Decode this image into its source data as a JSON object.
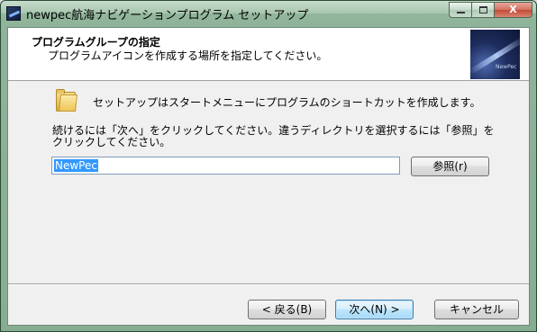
{
  "window": {
    "title": "newpec航海ナビゲーションプログラム セットアップ",
    "minimize_label": "",
    "maximize_label": "",
    "close_label": "X"
  },
  "header": {
    "title": "プログラムグループの指定",
    "subtitle": "プログラムアイコンを作成する場所を指定してください。",
    "image_caption": "NewPec"
  },
  "body": {
    "intro": "セットアップはスタートメニューにプログラムのショートカットを作成します。",
    "instruction": "続けるには「次へ」をクリックしてください。違うディレクトリを選択するには「参照」をクリックしてください。",
    "folder_value": "NewPec",
    "browse_label": "参照(r)"
  },
  "footer": {
    "back_label": "< 戻る(B)",
    "next_label": "次へ(N) >",
    "cancel_label": "キャンセル"
  },
  "colors": {
    "title_bar": "#9fc0a7",
    "selection": "#3399ff",
    "default_button_border": "#3c7fb1",
    "close_button": "#c04a37"
  },
  "icons": {
    "app": "app-ship-icon",
    "folder": "folder-icon"
  }
}
